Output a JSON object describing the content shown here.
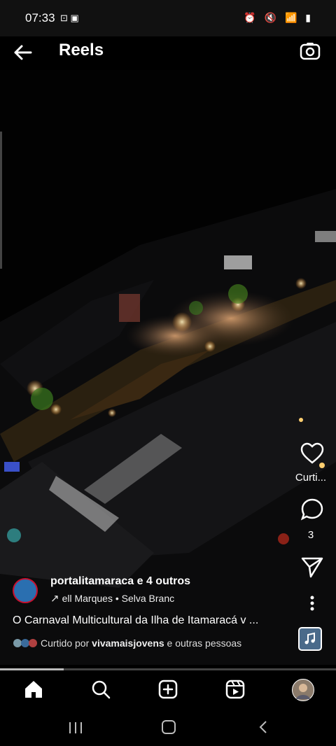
{
  "status_bar": {
    "time": "07:33",
    "left_icons": "⊡ ▣",
    "right_icons": "⏰ 🔇 📶 ▮"
  },
  "header": {
    "title": "Reels",
    "back_icon": "arrow-left-icon",
    "camera_icon": "camera-icon"
  },
  "rail": {
    "like_label": "Curti...",
    "comments_count": "3"
  },
  "post": {
    "username": "portalitamaraca",
    "coauthors": " e 4 outros",
    "music": "ell Marques • Selva Branc",
    "caption": "O Carnaval Multicultural da Ilha de Itamaracá v ...",
    "liked_prefix": "Curtido por ",
    "liked_user": "vivamaisjovens",
    "liked_suffix": " e outras pessoas",
    "progress": 0.19
  },
  "bottom_nav": [
    "home-icon",
    "search-icon",
    "create-icon",
    "reels-icon",
    "profile-avatar"
  ]
}
